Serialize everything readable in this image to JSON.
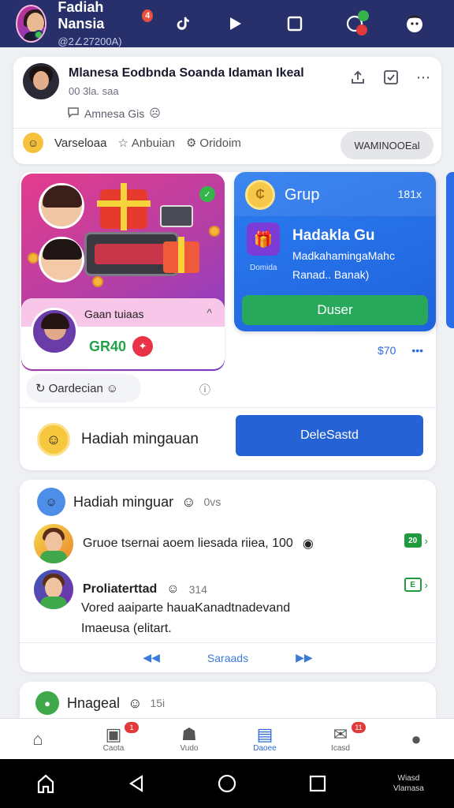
{
  "header": {
    "name": "Fadiah Nansia",
    "name_badge": "4",
    "handle": "@2∠27200A)",
    "icons": [
      "tiktok-icon",
      "play-icon",
      "stop-icon",
      "chat-notification-icon",
      "mascot-icon"
    ]
  },
  "post": {
    "title": "Mlanesa Eodbnda Soanda Idaman Ikeal",
    "subtitle": "00 3la. saa",
    "meta": "Amnesa Gis",
    "reaction_label": "Varseloaa",
    "action_1": "Anbuian",
    "action_2": "Oridoim",
    "pill_button": "WAMINOOEal"
  },
  "promo": {
    "host_name": "Gaan tuiaas",
    "score": "GR40",
    "gift_badge": "✓"
  },
  "group": {
    "label": "Grup",
    "count": "181x",
    "title": "Hadakla Gu",
    "small_label": "Domida",
    "desc_1": "MadkahamingaMahc",
    "desc_2": "Ranad.. Banak)",
    "button": "Duser"
  },
  "feature_meta": {
    "value": "$70",
    "more": "•••"
  },
  "order": {
    "label": "Oardecian"
  },
  "weekly": {
    "label": "Hadiah mingauan",
    "button": "DeleSastd"
  },
  "list": {
    "header": "Hadiah minguar",
    "header_small": "0vs",
    "item1_text": "Gruoe tsernai aoem liesada riiea, 100",
    "item1_tag": "20",
    "item2_title": "Proliaterttad",
    "item2_small": "314",
    "item2_tag": "E",
    "item2_body_1": "Vored aaiparte hauaKanadtnadevand",
    "item2_body_2": "Imaeusa (elitart.",
    "footer": "Saraads"
  },
  "peek": {
    "title": "Hnageal",
    "small": "15i"
  },
  "bottom_nav": [
    {
      "label": "",
      "icon": "home-icon"
    },
    {
      "label": "Caota",
      "icon": "camera-icon",
      "badge": "1"
    },
    {
      "label": "Vudo",
      "icon": "people-icon"
    },
    {
      "label": "Daoee",
      "icon": "document-icon"
    },
    {
      "label": "Icasd",
      "icon": "mail-icon",
      "badge": "11"
    },
    {
      "label": "",
      "icon": "profile-icon"
    }
  ],
  "system": {
    "brand_1": "Wiasd",
    "brand_2": "Vlamasa"
  }
}
